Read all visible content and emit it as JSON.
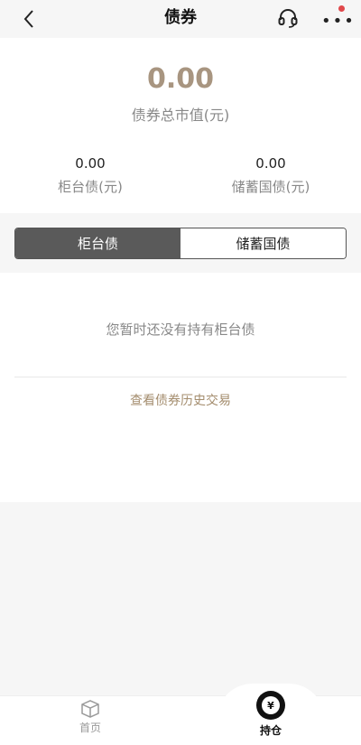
{
  "header": {
    "title": "债券",
    "back_icon": "chevron-left-icon",
    "service_icon": "headset-icon",
    "more_icon": "more-dots-icon",
    "notification_dot_color": "#e0484b"
  },
  "summary": {
    "total_value": "0.00",
    "total_label": "债券总市值(元)",
    "counter_value": "0.00",
    "counter_label": "柜台债(元)",
    "savings_value": "0.00",
    "savings_label": "储蓄国债(元)",
    "accent_color": "#a89580"
  },
  "tabs": [
    {
      "label": "柜台债",
      "active": true
    },
    {
      "label": "储蓄国债",
      "active": false
    }
  ],
  "content": {
    "empty_message": "您暂时还没有持有柜台债",
    "history_link": "查看债券历史交易"
  },
  "bottom_nav": {
    "home_label": "首页",
    "home_icon": "box-icon",
    "holdings_label": "持仓",
    "holdings_icon": "yen-coin-icon",
    "holdings_symbol": "¥"
  }
}
